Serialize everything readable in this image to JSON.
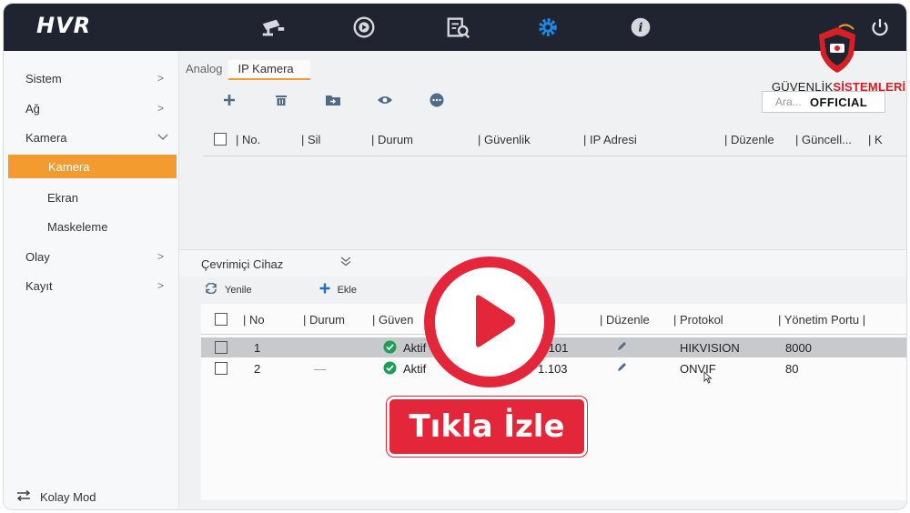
{
  "app": {
    "title": "HVR"
  },
  "topbar": {
    "icons": [
      "camera-icon",
      "playback-icon",
      "search-file-icon",
      "settings-icon",
      "info-icon"
    ],
    "settings_active_color": "#1e88e5"
  },
  "sidebar": {
    "items": [
      {
        "label": "Sistem"
      },
      {
        "label": "Ağ"
      },
      {
        "label": "Kamera"
      },
      {
        "label": "Kamera"
      },
      {
        "label": "Ekran"
      },
      {
        "label": "Maskeleme"
      },
      {
        "label": "Olay"
      },
      {
        "label": "Kayıt"
      }
    ],
    "footer": "Kolay Mod",
    "active_color": "#f39b2f"
  },
  "tabs": [
    {
      "label": "Analog"
    },
    {
      "label": "IP Kamera"
    }
  ],
  "toolbar": {
    "search_placeholder": "Ara...",
    "icons": [
      "add-icon",
      "delete-icon",
      "import-icon",
      "view-icon",
      "more-icon"
    ]
  },
  "camera_table": {
    "columns": [
      "No.",
      "Sil",
      "Durum",
      "Güvenlik",
      "IP Adresi",
      "Düzenle",
      "Güncell...",
      "K"
    ]
  },
  "online_section": {
    "title": "Çevrimiçi Cihaz",
    "refresh_label": "Yenile",
    "add_label": "Ekle",
    "columns": [
      "No",
      "Durum",
      "Güven",
      "Düzenle",
      "Protokol",
      "Yönetim Portu"
    ],
    "rows": [
      {
        "no": "1",
        "durum": "",
        "guvenlik": "Aktif",
        "ip": ".101",
        "protokol": "HIKVISION",
        "port": "8000"
      },
      {
        "no": "2",
        "durum": "—",
        "guvenlik": "Aktif",
        "ip": "1.103",
        "protokol": "ONVIF",
        "port": "80"
      }
    ]
  },
  "overlay": {
    "cta_label": "Tıkla İzle",
    "color": "#e4263a"
  },
  "watermark": {
    "brand_left": "GÜVENLİK",
    "brand_right": "SİSTEMLERİ",
    "brand_sub": "OFFICIAL"
  }
}
